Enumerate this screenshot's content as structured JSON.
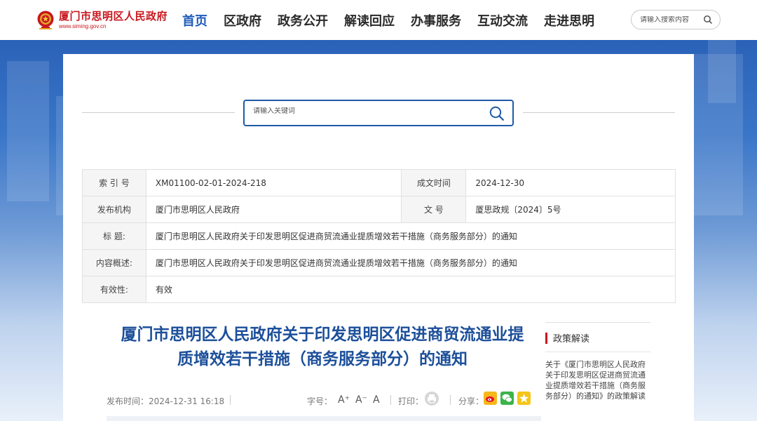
{
  "header": {
    "site_name": "厦门市思明区人民政府",
    "site_url": "www.siming.gov.cn",
    "nav": [
      {
        "label": "首页",
        "active": true
      },
      {
        "label": "区政府"
      },
      {
        "label": "政务公开"
      },
      {
        "label": "解读回应"
      },
      {
        "label": "办事服务"
      },
      {
        "label": "互动交流"
      },
      {
        "label": "走进思明"
      }
    ],
    "search_placeholder": "请输入搜索内容"
  },
  "main_search": {
    "placeholder": "请输入关键词"
  },
  "meta": {
    "index_label": "索 引 号",
    "index_value": "XM01100-02-01-2024-218",
    "date_label": "成文时间",
    "date_value": "2024-12-30",
    "publisher_label": "发布机构",
    "publisher_value": "厦门市思明区人民政府",
    "docno_label": "文 号",
    "docno_value": "厦思政规〔2024〕5号",
    "title_label": "标 题:",
    "title_value": "厦门市思明区人民政府关于印发思明区促进商贸流通业提质增效若干措施（商务服务部分）的通知",
    "summary_label": "内容概述:",
    "summary_value": "厦门市思明区人民政府关于印发思明区促进商贸流通业提质增效若干措施（商务服务部分）的通知",
    "validity_label": "有效性:",
    "validity_value": "有效"
  },
  "article": {
    "title_line1": "厦门市思明区人民政府关于印发思明区促进商贸流通业提",
    "title_line2": "质增效若干措施（商务服务部分）的通知",
    "publish_time": "发布时间：2024-12-31 16:18",
    "font_label": "字号：",
    "font_plus": "A⁺",
    "font_minus": "A⁻",
    "font_normal": "A",
    "print_label": "打印：",
    "share_label": "分享："
  },
  "side": {
    "heading": "政策解读",
    "link": "关于《厦门市思明区人民政府关于印发思明区促进商贸流通业提质增效若干措施（商务服务部分）的通知》的政策解读"
  },
  "colors": {
    "brand_red": "#c8161d",
    "nav_active": "#1e5bb8",
    "title_blue": "#1c4f9a",
    "search_border": "#1f5aa6"
  }
}
